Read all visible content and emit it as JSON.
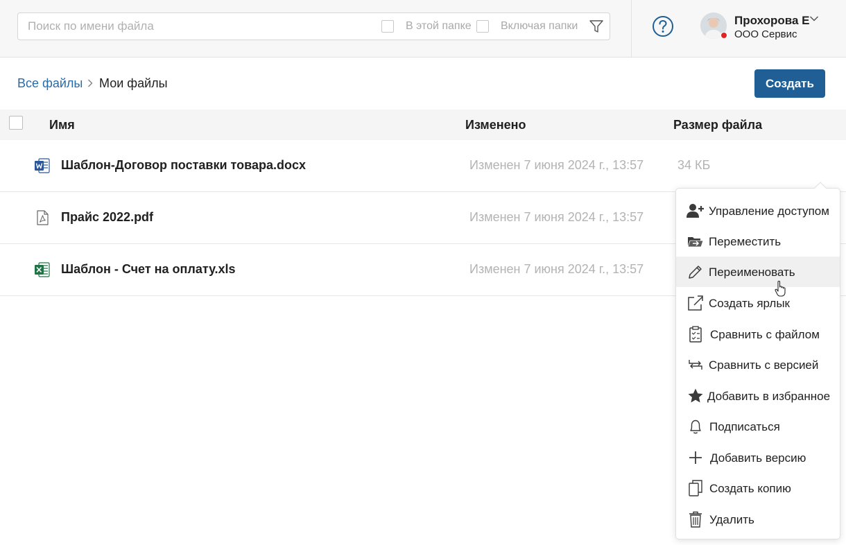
{
  "search": {
    "placeholder": "Поиск по имени файла",
    "in_folder_label": "В этой папке",
    "include_folders_label": "Включая папки"
  },
  "user": {
    "name": "Прохорова Е",
    "org": "ООО Сервис",
    "status_color": "#e02424"
  },
  "breadcrumb": {
    "root": "Все файлы",
    "current": "Мои файлы"
  },
  "toolbar": {
    "create_label": "Создать"
  },
  "table": {
    "headers": {
      "name": "Имя",
      "modified": "Изменено",
      "size": "Размер файла"
    },
    "rows": [
      {
        "icon": "word-file-icon",
        "name": "Шаблон-Договор поставки товара.docx",
        "modified": "Изменен 7 июня 2024 г., 13:57",
        "size": "34 КБ"
      },
      {
        "icon": "pdf-file-icon",
        "name": "Прайс 2022.pdf",
        "modified": "Изменен 7 июня 2024 г., 13:57",
        "size": ""
      },
      {
        "icon": "excel-file-icon",
        "name": "Шаблон - Счет на оплату.xls",
        "modified": "Изменен 7 июня 2024 г., 13:57",
        "size": ""
      }
    ]
  },
  "context_menu": {
    "items": [
      {
        "label": "Управление доступом",
        "icon": "user-add-icon"
      },
      {
        "label": "Переместить",
        "icon": "folder-move-icon"
      },
      {
        "label": "Переименовать",
        "icon": "pencil-icon",
        "hovered": true
      },
      {
        "label": "Создать ярлык",
        "icon": "shortcut-icon"
      },
      {
        "label": "Сравнить с файлом",
        "icon": "clipboard-compare-icon"
      },
      {
        "label": "Сравнить с версией",
        "icon": "version-compare-icon"
      },
      {
        "label": "Добавить в избранное",
        "icon": "star-icon"
      },
      {
        "label": "Подписаться",
        "icon": "bell-icon"
      },
      {
        "label": "Добавить версию",
        "icon": "plus-icon"
      },
      {
        "label": "Создать копию",
        "icon": "copy-icon"
      },
      {
        "label": "Удалить",
        "icon": "trash-icon"
      }
    ]
  },
  "colors": {
    "accent": "#1f5f95",
    "link": "#2a6aa6",
    "word": "#2b579a",
    "excel": "#217346"
  }
}
